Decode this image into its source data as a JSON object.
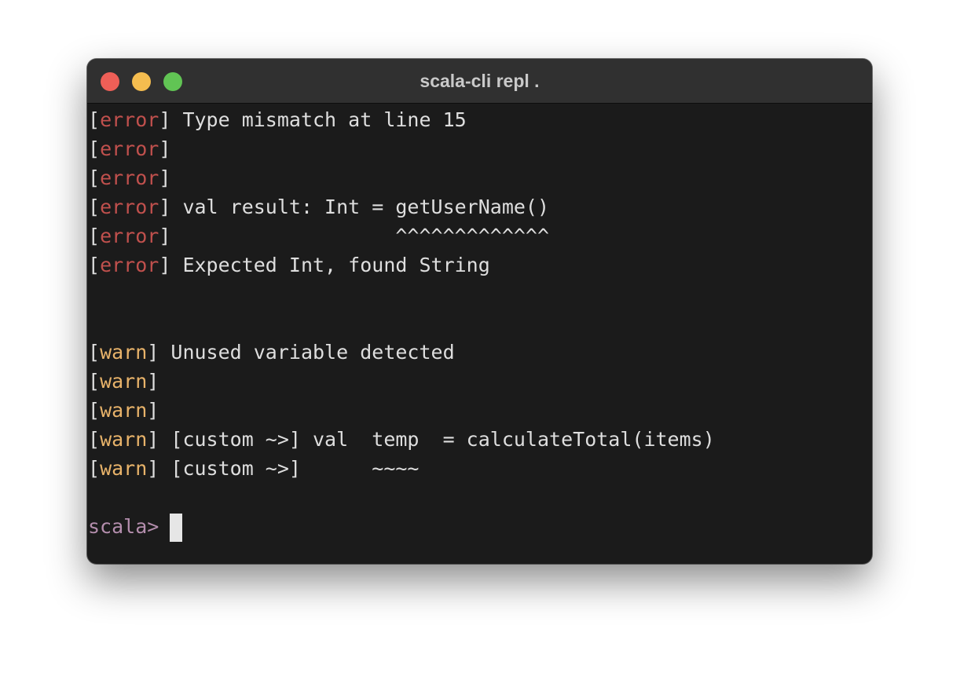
{
  "window": {
    "title": "scala-cli repl .",
    "traffic_lights": {
      "close_color": "#ee5f57",
      "minimize_color": "#f5bd4f",
      "zoom_color": "#61c454"
    }
  },
  "terminal": {
    "colors": {
      "error_tag": "#c0504d",
      "warn_tag": "#e8b36a",
      "prompt": "#b48ead",
      "text": "#dedede",
      "background": "#1b1b1b"
    },
    "error_lines": [
      {
        "tag": "error",
        "text": " Type mismatch at line 15"
      },
      {
        "tag": "error",
        "text": ""
      },
      {
        "tag": "error",
        "text": ""
      },
      {
        "tag": "error",
        "text": " val result: Int = getUserName()"
      },
      {
        "tag": "error",
        "text": "                   ^^^^^^^^^^^^^"
      },
      {
        "tag": "error",
        "text": " Expected Int, found String"
      }
    ],
    "warn_lines": [
      {
        "tag": "warn",
        "text": " Unused variable detected"
      },
      {
        "tag": "warn",
        "text": ""
      },
      {
        "tag": "warn",
        "text": ""
      },
      {
        "tag": "warn",
        "text": " [custom ~>] val  temp  = calculateTotal(items)"
      },
      {
        "tag": "warn",
        "text": " [custom ~>]      ~~~~"
      }
    ],
    "prompt": "scala>"
  }
}
